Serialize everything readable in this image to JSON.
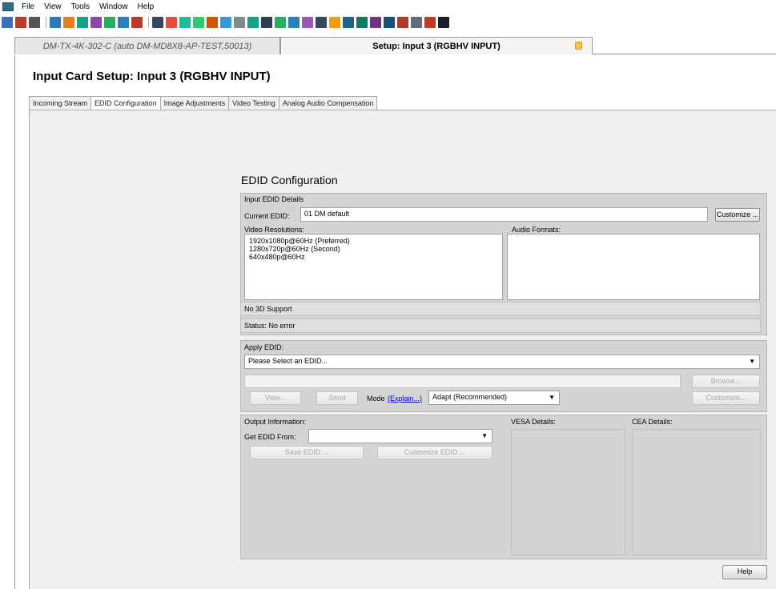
{
  "menu": {
    "items": [
      "File",
      "View",
      "Tools",
      "Window",
      "Help"
    ]
  },
  "toolbar": {
    "icon_colors": [
      "#3b6fb6",
      "#c0392b",
      "#555555",
      "#2c7bb6",
      "#e67e22",
      "#16a085",
      "#8e44ad",
      "#27ae60",
      "#2980b9",
      "#c0392b",
      "#34495e",
      "#e74c3c",
      "#1abc9c",
      "#2ecc71",
      "#d35400",
      "#3498db",
      "#7f8c8d",
      "#16a085",
      "#2c3e50",
      "#27ae60",
      "#2980b9",
      "#9b59b6",
      "#34495e",
      "#f39c12",
      "#1f618d",
      "#117a65",
      "#6c3483",
      "#1a5276",
      "#b03a2e",
      "#5d6d7e",
      "#c0392b",
      "#17202a"
    ]
  },
  "doc_tabs": {
    "inactive": "DM-TX-4K-302-C (auto DM-MD8X8-AP-TEST,50013)",
    "active": "Setup: Input 3 (RGBHV INPUT)"
  },
  "page": {
    "title": "Input Card Setup: Input 3 (RGBHV INPUT)"
  },
  "sub_tabs": [
    "Incoming Stream",
    "EDID Configuration",
    "Image Adjustments",
    "Video Testing",
    "Analog Audio Compensation"
  ],
  "edid": {
    "title": "EDID Configuration",
    "input_details_label": "Input EDID Details",
    "current_edid_label": "Current EDID:",
    "current_edid_value": "01 DM default",
    "customize_label": "Customize ...",
    "video_res_label": "Video Resolutions:",
    "video_resolutions": [
      "1920x1080p@60Hz (Preferred)",
      "1280x720p@60Hz (Second)",
      "640x480p@60Hz"
    ],
    "audio_formats_label": "Audio Formats:",
    "support_3d": "No 3D Support",
    "status": "Status: No error",
    "apply_label": "Apply EDID:",
    "apply_select": "Please Select an EDID...",
    "browse_label": "Browse...",
    "view_label": "View...",
    "send_label": "Send",
    "mode_label": "Mode",
    "explain_label": "(Explain...)",
    "mode_value": "Adapt (Recommended)",
    "customize2_label": "Customize...",
    "output_label": "Output Information:",
    "get_edid_label": "Get EDID From:",
    "save_label": "Save EDID ...",
    "customize3_label": "Customize EDID ...",
    "vesa_label": "VESA Details:",
    "cea_label": "CEA Details:"
  },
  "footer": {
    "help_label": "Help"
  }
}
